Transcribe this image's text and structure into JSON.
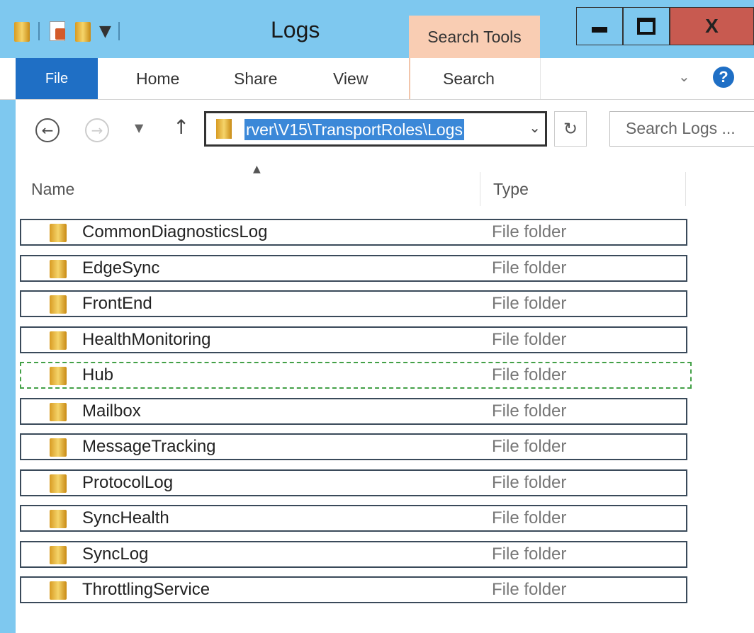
{
  "window": {
    "title": "Logs",
    "context_tab": "Search Tools",
    "close_glyph": "X"
  },
  "ribbon": {
    "tabs": {
      "file": "File",
      "home": "Home",
      "share": "Share",
      "view": "View",
      "search": "Search"
    },
    "help_glyph": "?"
  },
  "navigation": {
    "address_path": "rver\\V15\\TransportRoles\\Logs",
    "search_placeholder": "Search Logs ..."
  },
  "columns": {
    "name": "Name",
    "type": "Type"
  },
  "rows": [
    {
      "name": "CommonDiagnosticsLog",
      "type": "File folder"
    },
    {
      "name": "EdgeSync",
      "type": "File folder"
    },
    {
      "name": "FrontEnd",
      "type": "File folder"
    },
    {
      "name": "HealthMonitoring",
      "type": "File folder"
    },
    {
      "name": "Hub",
      "type": "File folder"
    },
    {
      "name": "Mailbox",
      "type": "File folder"
    },
    {
      "name": "MessageTracking",
      "type": "File folder"
    },
    {
      "name": "ProtocolLog",
      "type": "File folder"
    },
    {
      "name": "SyncHealth",
      "type": "File folder"
    },
    {
      "name": "SyncLog",
      "type": "File folder"
    },
    {
      "name": "ThrottlingService",
      "type": "File folder"
    }
  ],
  "selected_row": "Hub",
  "icons": {
    "folder": "folder-icon",
    "back": "back-arrow-icon",
    "forward": "forward-arrow-icon",
    "up": "up-arrow-icon",
    "refresh": "refresh-icon"
  },
  "colors": {
    "title_bar": "#7ec8ef",
    "search_tools_tab": "#f9cdb3",
    "file_tab": "#1f6fc5",
    "close_button": "#c85a50",
    "address_highlight": "#3b88d8",
    "selection_dash": "#43a047"
  }
}
